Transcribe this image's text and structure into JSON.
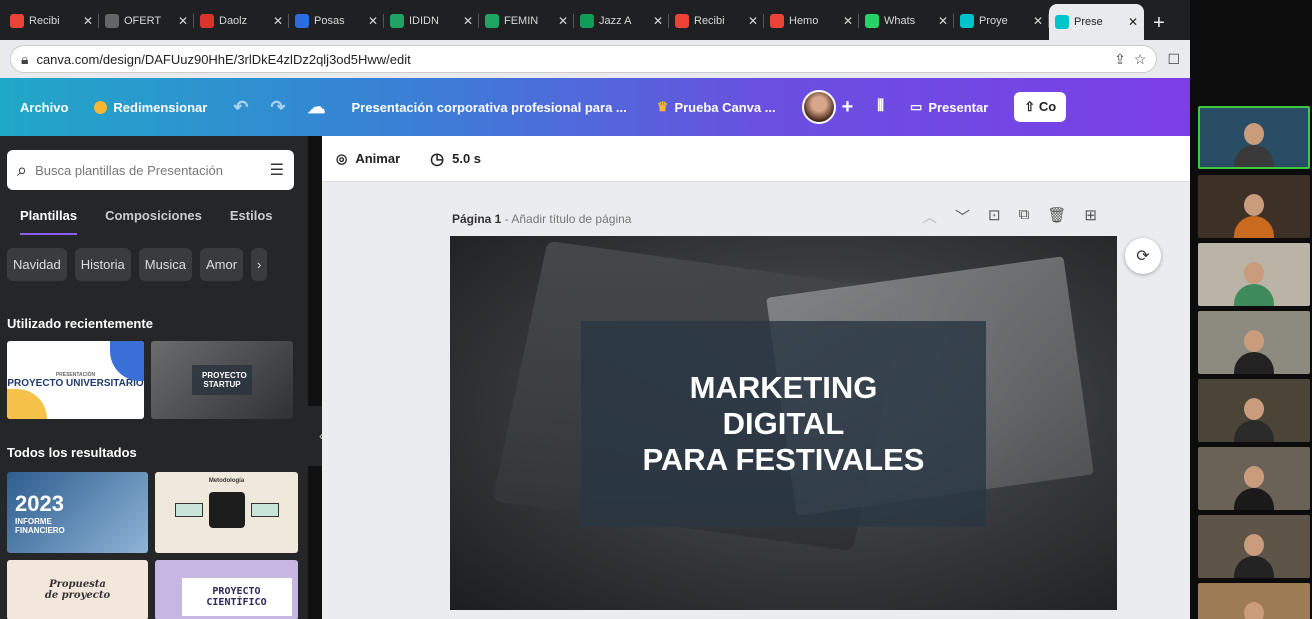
{
  "browser": {
    "tabs": [
      {
        "label": "Recibi",
        "icon": "gmail-icon",
        "color": "#ea4335"
      },
      {
        "label": "OFERT",
        "icon": "globe-icon",
        "color": "#666666"
      },
      {
        "label": "Daolz",
        "icon": "app-icon",
        "color": "#d9342b"
      },
      {
        "label": "Posas",
        "icon": "z-icon",
        "color": "#2d6cdf"
      },
      {
        "label": "IDIDN",
        "icon": "drive-icon",
        "color": "#1fa463"
      },
      {
        "label": "FEMIN",
        "icon": "drive-icon",
        "color": "#1fa463"
      },
      {
        "label": "Jazz A",
        "icon": "sheets-icon",
        "color": "#0f9d58"
      },
      {
        "label": "Recibi",
        "icon": "gmail-icon",
        "color": "#ea4335"
      },
      {
        "label": "Hemo",
        "icon": "gmail-icon",
        "color": "#ea4335"
      },
      {
        "label": "Whats",
        "icon": "whatsapp-icon",
        "color": "#25d366"
      },
      {
        "label": "Proye",
        "icon": "canva-icon",
        "color": "#00c4cc"
      },
      {
        "label": "Prese",
        "icon": "canva-icon",
        "color": "#00c4cc",
        "active": true
      }
    ],
    "new_tab": "+",
    "url": "canva.com/design/DAFUuz90HhE/3rlDkE4zlDz2qlj3od5Hww/edit"
  },
  "header": {
    "file": "Archivo",
    "resize": "Redimensionar",
    "doc_title": "Presentación corporativa profesional para ...",
    "trial": "Prueba Canva ...",
    "present": "Presentar",
    "share": "Co"
  },
  "panel": {
    "search_placeholder": "Busca plantillas de Presentación",
    "tabs": [
      "Plantillas",
      "Composiciones",
      "Estilos"
    ],
    "chips": [
      "Navidad",
      "Historia",
      "Musica",
      "Amor"
    ],
    "recent_heading": "Utilizado recientemente",
    "results_heading": "Todos los resultados",
    "thumbs": {
      "t1_small": "PRESENTACIÓN",
      "t1_title": "PROYECTO UNIVERSITARIO",
      "t2_title": "PROYECTO STARTUP",
      "t3_year": "2023",
      "t3_sub": "INFORME FINANCIERO",
      "t4_title": "Metodología",
      "t5_title": "Propuesta de proyecto",
      "t6_title": "PROYECTO CIENTÍFICO"
    }
  },
  "editor": {
    "animate": "Animar",
    "duration": "5.0 s",
    "page_label": "Página 1",
    "page_sub": "- Añadir título de página",
    "slide_lines": [
      "MARKETING",
      "DIGITAL",
      "PARA FESTIVALES"
    ]
  },
  "video": {
    "tiles": [
      {
        "bg": "#2a4d66",
        "body": "#3a3a3a"
      },
      {
        "bg": "#3d3127",
        "body": "#c96a1e"
      },
      {
        "bg": "#b9b4a6",
        "body": "#3f8a5a"
      },
      {
        "bg": "#8d8a80",
        "body": "#222222"
      },
      {
        "bg": "#4a4536",
        "body": "#2b2b2b"
      },
      {
        "bg": "#6b6257",
        "body": "#1a1a1a"
      },
      {
        "bg": "#5e5548",
        "body": "#232323"
      },
      {
        "bg": "#9c7b55",
        "body": "#6d5030"
      }
    ]
  }
}
